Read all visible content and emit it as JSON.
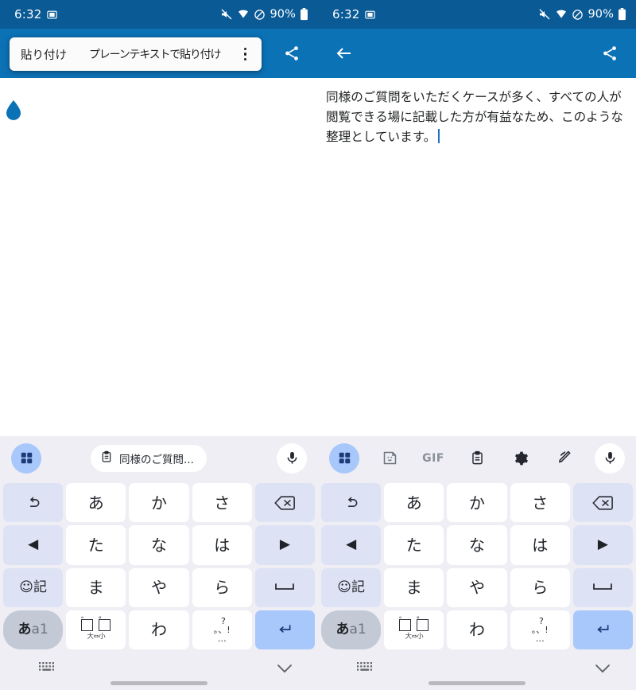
{
  "status_bar": {
    "time": "6:32",
    "battery_percent": "90%",
    "icons": [
      "cast-icon",
      "mute-icon",
      "wifi-icon",
      "do-not-disturb-icon",
      "battery-icon"
    ]
  },
  "toolbar": {
    "back_label": "back-arrow",
    "share_label": "share"
  },
  "context_menu": {
    "paste_label": "貼り付け",
    "paste_plain_label": "プレーンテキストで貼り付け",
    "overflow_label": "more-options"
  },
  "document": {
    "text": "同様のご質問をいただくケースが多く、すべての人が閲覧できる場に記載した方が有益なため、このような整理としています。",
    "caret_visible": "true",
    "selection_handle": "drop-handle"
  },
  "keyboard": {
    "clipboard_chip": "同様のご質問...",
    "toolbar_icons": [
      "apps-grid-icon",
      "sticker-icon",
      "gif-icon",
      "clipboard-icon",
      "settings-gear-icon",
      "handwriting-icon",
      "mic-icon"
    ],
    "gif_label": "GIF",
    "rows": [
      [
        {
          "name": "undo-key",
          "label": "↺",
          "type": "fn"
        },
        {
          "name": "key-a",
          "label": "あ",
          "type": "char"
        },
        {
          "name": "key-ka",
          "label": "か",
          "type": "char"
        },
        {
          "name": "key-sa",
          "label": "さ",
          "type": "char"
        },
        {
          "name": "backspace-key",
          "label": "⌫",
          "type": "fn"
        }
      ],
      [
        {
          "name": "cursor-left-key",
          "label": "◀",
          "type": "fn"
        },
        {
          "name": "key-ta",
          "label": "た",
          "type": "char"
        },
        {
          "name": "key-na",
          "label": "な",
          "type": "char"
        },
        {
          "name": "key-ha",
          "label": "は",
          "type": "char"
        },
        {
          "name": "cursor-right-key",
          "label": "▶",
          "type": "fn"
        }
      ],
      [
        {
          "name": "emoji-symbol-key",
          "label": "☺記",
          "type": "fn"
        },
        {
          "name": "key-ma",
          "label": "ま",
          "type": "char"
        },
        {
          "name": "key-ya",
          "label": "や",
          "type": "char"
        },
        {
          "name": "key-ra",
          "label": "ら",
          "type": "char"
        },
        {
          "name": "space-key",
          "label": "␣",
          "type": "fn"
        }
      ],
      [
        {
          "name": "input-mode-key",
          "label": "あa1",
          "type": "mode"
        },
        {
          "name": "dakuten-key",
          "label": "゛゜",
          "sub": "大⇔小",
          "type": "char"
        },
        {
          "name": "key-wa",
          "label": "わ",
          "type": "char"
        },
        {
          "name": "punctuation-key",
          "label": "、。?!…",
          "type": "char"
        },
        {
          "name": "enter-key",
          "label": "↵",
          "type": "enter"
        }
      ]
    ],
    "bottom": {
      "switch_keyboard": "keyboard-switch-icon",
      "hide_keyboard": "chevron-down-icon",
      "home_indicator": "home-indicator"
    }
  },
  "colors": {
    "status_bar": "#0a5a96",
    "toolbar": "#0c72b6",
    "accent": "#a8c7fa",
    "keyboard_bg": "#eeeef4",
    "caret": "#1a73c8",
    "handle": "#0c72b6"
  }
}
